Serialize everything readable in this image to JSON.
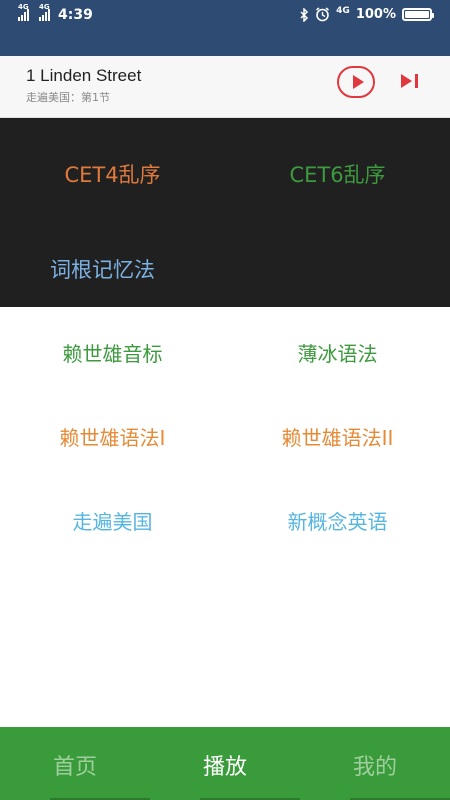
{
  "status_bar": {
    "network_left_1": "4G",
    "network_left_2": "4G",
    "time": "4:39",
    "network_right": "4G",
    "battery": "100%",
    "icons": [
      "bluetooth-icon",
      "alarm-icon",
      "signal-icon",
      "battery-icon"
    ]
  },
  "now_playing": {
    "title": "1 Linden Street",
    "subtitle": "走遍美国：第1节",
    "play_icon": "play-icon",
    "next_icon": "skip-next-icon",
    "accent_color": "#e0383e"
  },
  "dark_menu": [
    {
      "label": "CET4乱序",
      "color": "#e07a3c"
    },
    {
      "label": "CET6乱序",
      "color": "#3d9a3e"
    },
    {
      "label": "词根记忆法",
      "color": "#7cb2e3"
    }
  ],
  "light_menu": [
    {
      "label": "赖世雄音标",
      "color": "#3d9a3e"
    },
    {
      "label": "薄冰语法",
      "color": "#3d9a3e"
    },
    {
      "label": "赖世雄语法I",
      "color": "#e58a36"
    },
    {
      "label": "赖世雄语法II",
      "color": "#e58a36"
    },
    {
      "label": "走遍美国",
      "color": "#56b6e0"
    },
    {
      "label": "新概念英语",
      "color": "#56b6e0"
    }
  ],
  "tabs": [
    {
      "label": "首页",
      "active": false
    },
    {
      "label": "播放",
      "active": true
    },
    {
      "label": "我的",
      "active": false
    }
  ],
  "colors": {
    "status_bar_bg": "#2d4b73",
    "tab_bar_bg": "#3a9b3a",
    "dark_panel_bg": "#202020"
  }
}
